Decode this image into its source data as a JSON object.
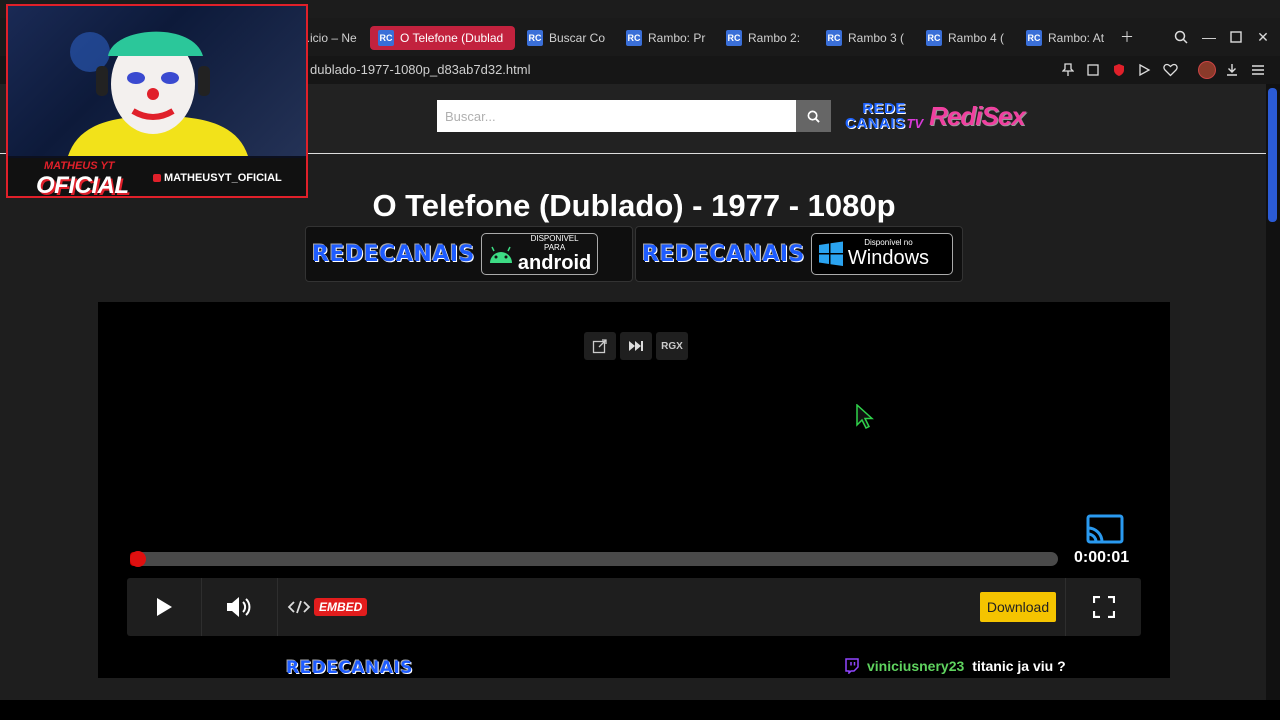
{
  "browser": {
    "tabs": [
      {
        "label": "...icio – Ne",
        "active": false
      },
      {
        "label": "O Telefone (Dublad",
        "active": true
      },
      {
        "label": "Buscar Co",
        "active": false
      },
      {
        "label": "Rambo: Pr",
        "active": false
      },
      {
        "label": "Rambo 2:",
        "active": false
      },
      {
        "label": "Rambo 3 (",
        "active": false
      },
      {
        "label": "Rambo 4 (",
        "active": false
      },
      {
        "label": "Rambo: At",
        "active": false
      }
    ],
    "url": "dublado-1977-1080p_d83ab7d32.html"
  },
  "site": {
    "search_placeholder": "Buscar...",
    "logo_rede": "REDE",
    "logo_canais": "CANAIS",
    "logo_tv": "TV",
    "logo_redisex": "RediSex",
    "page_title": "O Telefone (Dublado) - 1977 - 1080p",
    "promo_android": {
      "brand": "REDECANAIS",
      "line1": "DISPONIVEL",
      "line2": "PARA",
      "os": "android"
    },
    "promo_windows": {
      "brand": "REDECANAIS",
      "line1": "Disponível no",
      "os": "Windows"
    },
    "footer_logo": "REDECANAIS"
  },
  "player": {
    "tool_rgx": "RGX",
    "timecode": "0:00:01",
    "progress": 0.008,
    "embed_label": "EMBED",
    "download_label": "Download"
  },
  "chat": {
    "user": "viniciusnery23",
    "message": "titanic ja viu ?"
  },
  "webcam": {
    "tag": "MATHEUS YT",
    "name": "OFICIAL",
    "handle": "MATHEUSYT_OFICIAL"
  },
  "colors": {
    "accent": "#c2223e",
    "progress": "#e01010",
    "download": "#f5c400",
    "chat_user": "#5fd35f"
  }
}
